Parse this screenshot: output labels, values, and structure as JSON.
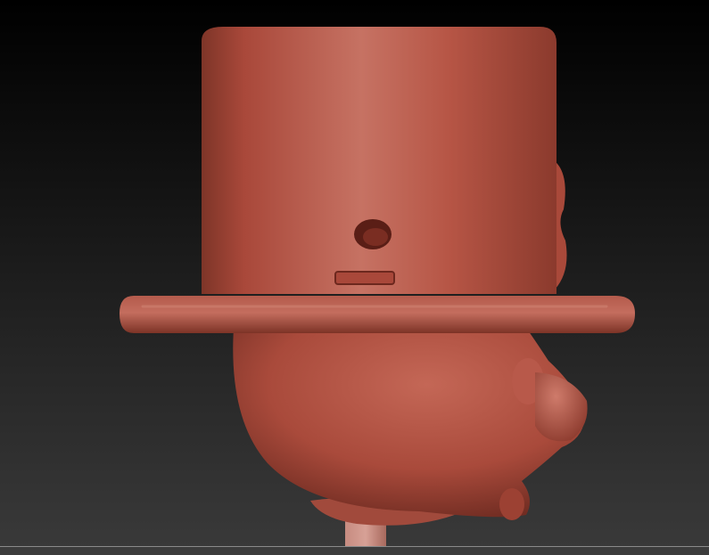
{
  "viewport": {
    "description_icon": "sculpt-model",
    "material_color": "#b65545",
    "background_top": "#000000",
    "background_bottom": "#3a3a3a"
  },
  "model": {
    "parts": [
      "top-hat-crown",
      "hat-brim",
      "head",
      "nose",
      "collar",
      "neck-stick",
      "hat-band-notch",
      "hat-hole"
    ]
  }
}
